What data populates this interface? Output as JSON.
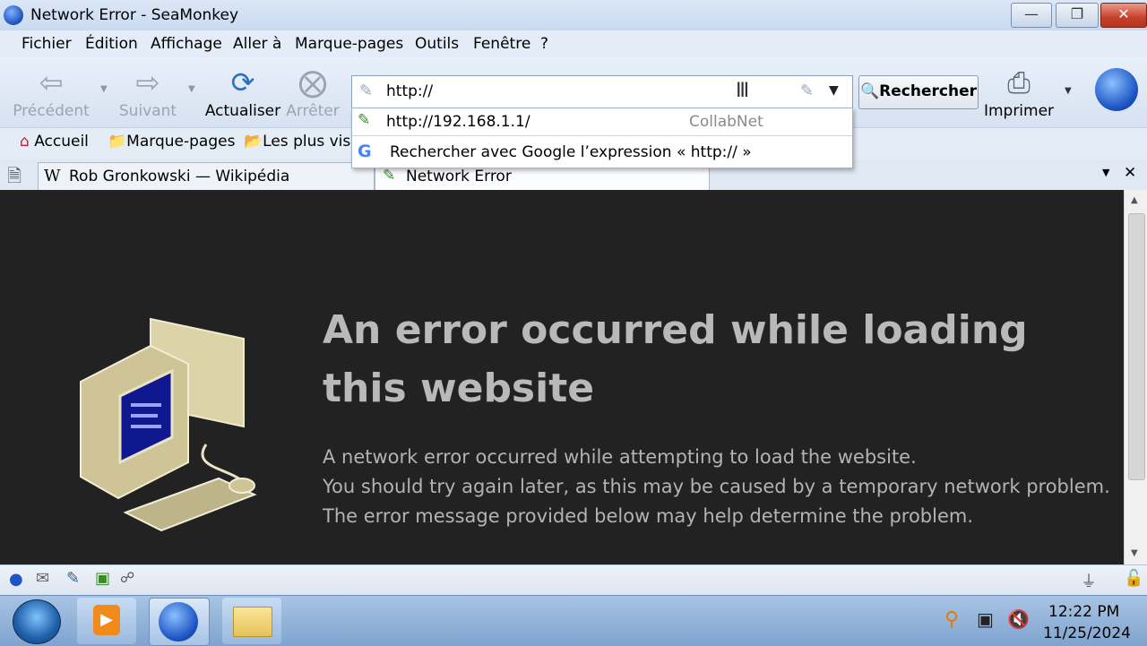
{
  "window": {
    "title": "Network Error - SeaMonkey",
    "min_icon": "minimize-icon",
    "max_icon": "restore-icon",
    "close_icon": "close-icon"
  },
  "menubar": {
    "items": [
      "Fichier",
      "Édition",
      "Affichage",
      "Aller à",
      "Marque-pages",
      "Outils",
      "Fenêtre",
      "?"
    ]
  },
  "navbar": {
    "back_label": "Précédent",
    "forward_label": "Suivant",
    "reload_label": "Actualiser",
    "stop_label": "Arrêter",
    "url_value": "http://",
    "search_label": "Rechercher",
    "print_label": "Imprimer"
  },
  "autocomplete": {
    "suggestion_url": "http://192.168.1.1/",
    "suggestion_title": "CollabNet",
    "search_text": "Rechercher avec Google l’expression « http:// »"
  },
  "bookmarks": {
    "home": "Accueil",
    "bookmarks": "Marque-pages",
    "most_visited": "Les plus visi"
  },
  "tabs": [
    {
      "label": "Rob Gronkowski — Wikipédia",
      "icon": "W"
    },
    {
      "label": "Network Error"
    }
  ],
  "error_page": {
    "title": "An error occurred while loading this website",
    "line1": "A network error occurred while attempting to load the website.",
    "line2": "You should try again later, as this may be caused by a temporary network problem.",
    "line3": "The error message provided below may help determine the problem."
  },
  "taskbar": {
    "time": "12:22 PM",
    "date": "11/25/2024"
  },
  "colors": {
    "content_bg": "#222222",
    "error_text": "#b9b9b9",
    "accent_blue": "#1a4fb8"
  }
}
